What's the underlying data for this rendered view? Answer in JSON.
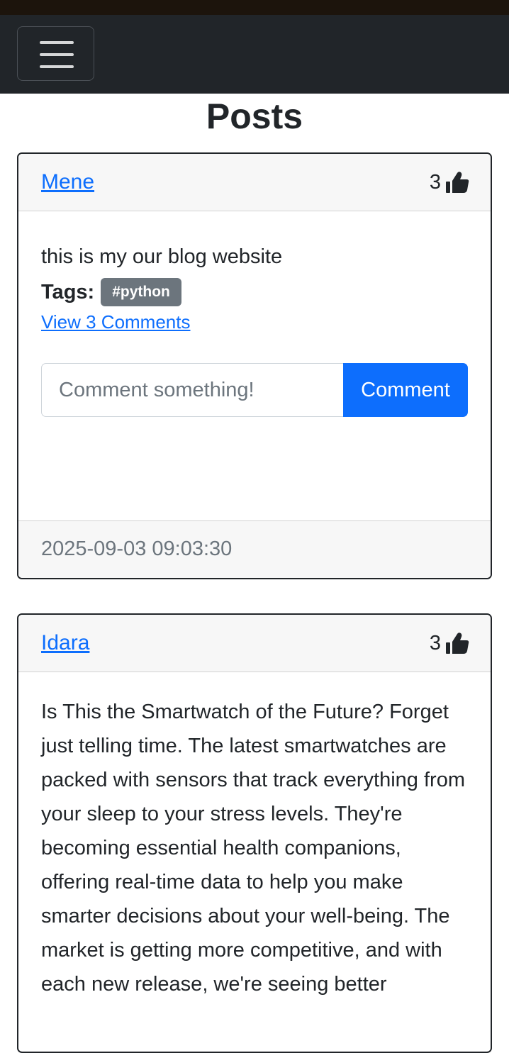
{
  "page": {
    "title": "Posts"
  },
  "colors": {
    "navbar": "#212529",
    "link": "#0d6efd",
    "primary_button": "#0d6efd",
    "badge": "#6c757d"
  },
  "posts": [
    {
      "author": "Mene",
      "likes": "3",
      "like_icon": "thumbs-up-icon",
      "text": "this is my our blog website",
      "tags_label": "Tags:",
      "tags": [
        "#python"
      ],
      "view_comments": "View 3 Comments",
      "comment_placeholder": "Comment something!",
      "comment_button": "Comment",
      "timestamp": "2025-09-03 09:03:30"
    },
    {
      "author": "Idara",
      "likes": "3",
      "like_icon": "thumbs-up-icon",
      "text": "Is This the Smartwatch of the Future? Forget just telling time. The latest smartwatches are packed with sensors that track everything from your sleep to your stress levels. They're becoming essential health companions, offering real-time data to help you make smarter decisions about your well-being. The market is getting more competitive, and with each new release, we're seeing better"
    }
  ],
  "navbar": {
    "toggler_icon": "hamburger-menu-icon"
  }
}
